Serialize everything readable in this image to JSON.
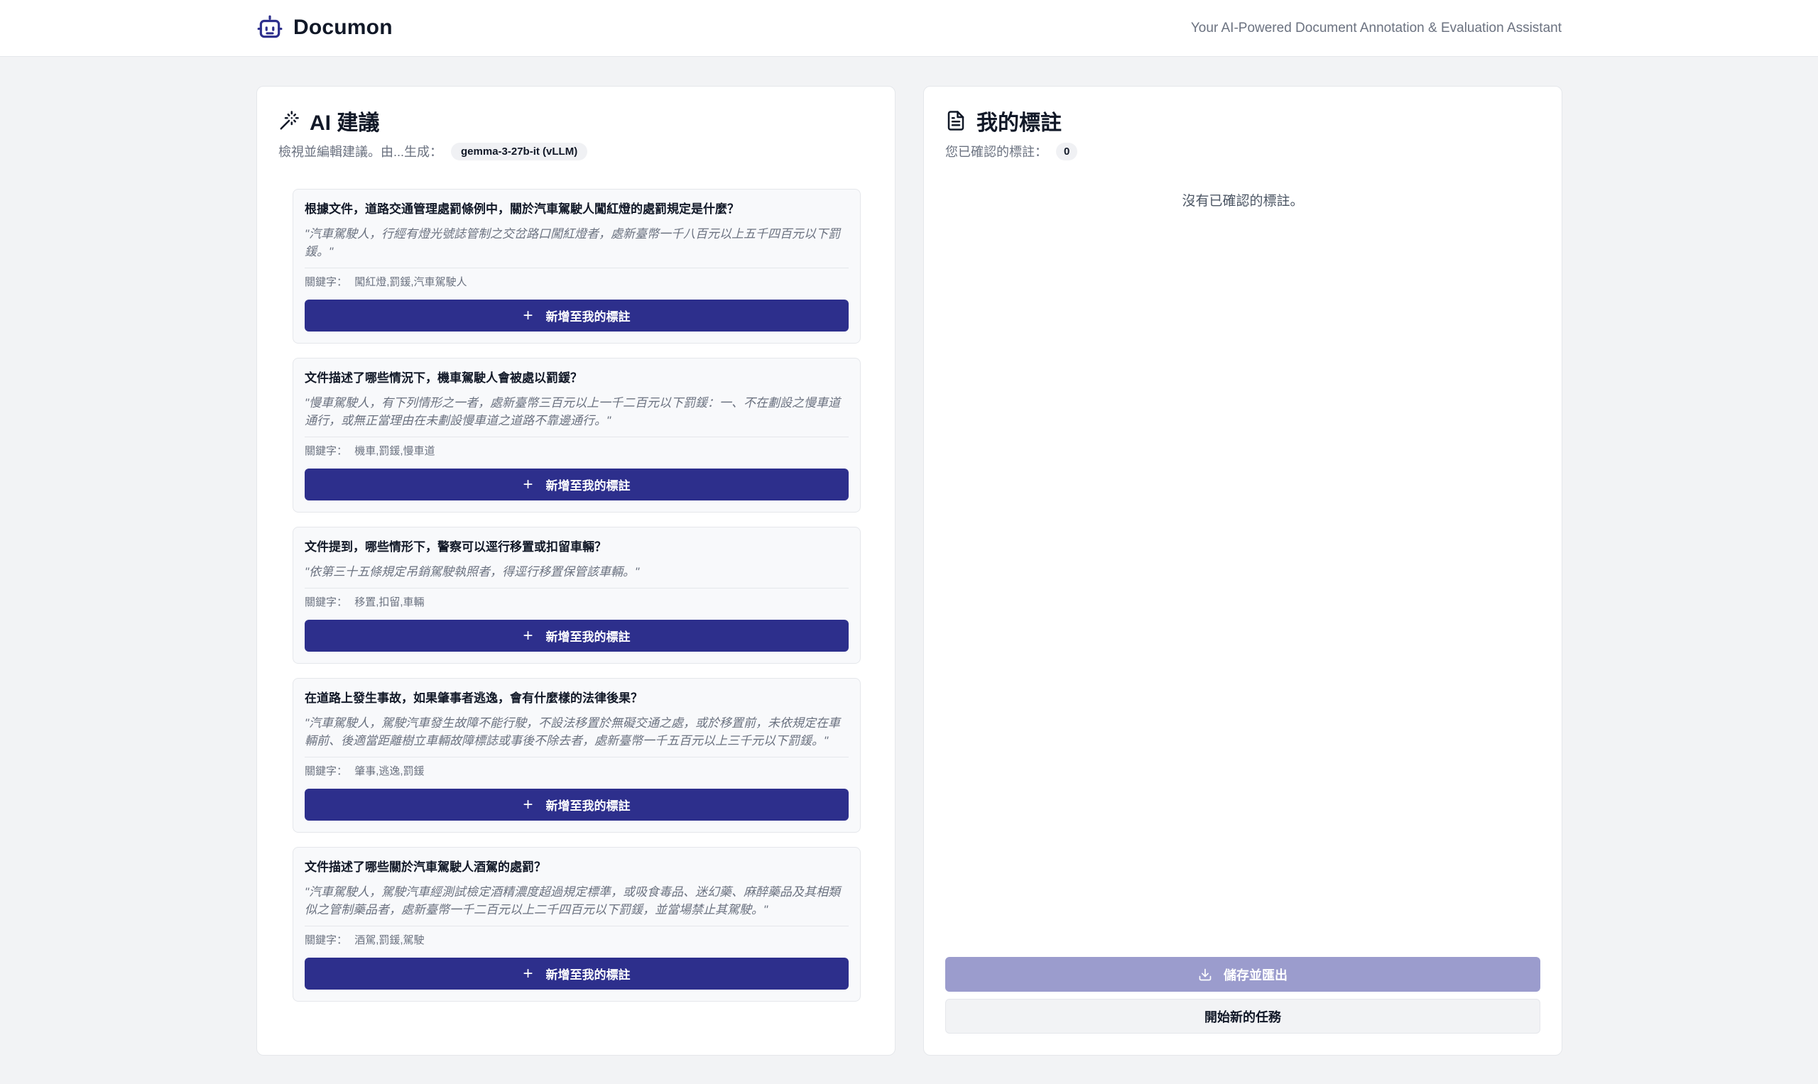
{
  "header": {
    "app_name": "Documon",
    "tagline": "Your AI-Powered Document Annotation & Evaluation Assistant",
    "logo_icon": "robot-icon"
  },
  "suggestions_panel": {
    "title": "AI 建議",
    "subtitle": "檢視並編輯建議。由...生成：",
    "model": "gemma-3-27b-it (vLLM)",
    "keyword_label": "關鍵字：",
    "add_button_label": "新增至我的標註",
    "items": [
      {
        "question": "根據文件，道路交通管理處罰條例中，關於汽車駕駛人闖紅燈的處罰規定是什麼？",
        "quote": "\"汽車駕駛人，行經有燈光號誌管制之交岔路口闖紅燈者，處新臺幣一千八百元以上五千四百元以下罰鍰。\"",
        "keywords": "闖紅燈,罰鍰,汽車駕駛人"
      },
      {
        "question": "文件描述了哪些情況下，機車駕駛人會被處以罰鍰？",
        "quote": "\"慢車駕駛人，有下列情形之一者，處新臺幣三百元以上一千二百元以下罰鍰：一、不在劃設之慢車道通行，或無正當理由在未劃設慢車道之道路不靠邊通行。\"",
        "keywords": "機車,罰鍰,慢車道"
      },
      {
        "question": "文件提到，哪些情形下，警察可以逕行移置或扣留車輛？",
        "quote": "\"依第三十五條規定吊銷駕駛執照者，得逕行移置保管該車輛。\"",
        "keywords": "移置,扣留,車輛"
      },
      {
        "question": "在道路上發生事故，如果肇事者逃逸，會有什麼樣的法律後果？",
        "quote": "\"汽車駕駛人，駕駛汽車發生故障不能行駛，不設法移置於無礙交通之處，或於移置前，未依規定在車輛前、後適當距離樹立車輛故障標誌或事後不除去者，處新臺幣一千五百元以上三千元以下罰鍰。\"",
        "keywords": "肇事,逃逸,罰鍰"
      },
      {
        "question": "文件描述了哪些關於汽車駕駛人酒駕的處罰？",
        "quote": "\"汽車駕駛人，駕駛汽車經測試檢定酒精濃度超過規定標準，或吸食毒品、迷幻藥、麻醉藥品及其相類似之管制藥品者，處新臺幣一千二百元以上二千四百元以下罰鍰，並當場禁止其駕駛。\"",
        "keywords": "酒駕,罰鍰,駕駛"
      }
    ]
  },
  "annotations_panel": {
    "title": "我的標註",
    "subtitle": "您已確認的標註：",
    "count": "0",
    "empty_text": "沒有已確認的標註。",
    "save_button": "儲存並匯出",
    "new_task_button": "開始新的任務"
  },
  "colors": {
    "primary": "#2d2f8c",
    "primary_disabled": "#9b9ccd",
    "background": "#f2f3f5"
  }
}
